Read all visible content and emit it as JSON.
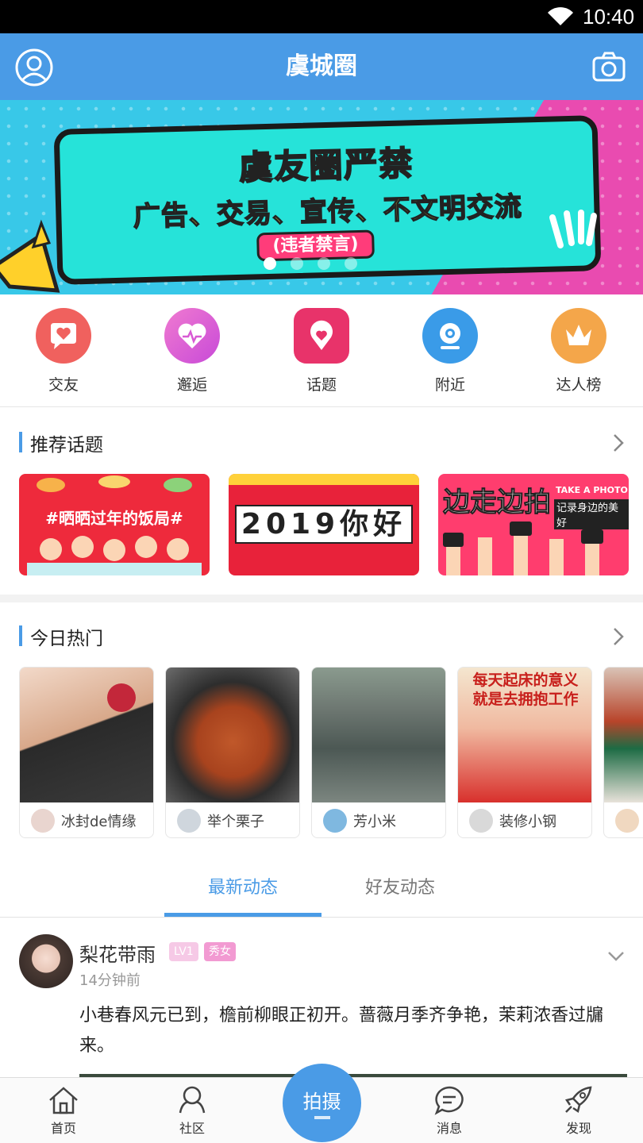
{
  "status_bar": {
    "time": "10:40",
    "icons": [
      "wifi-icon"
    ]
  },
  "header": {
    "title": "虞城圈",
    "left_icon": "user-avatar-icon",
    "right_icon": "camera-icon"
  },
  "banner": {
    "title": "虞友圈严禁",
    "subtitle": "广告、交易、宣传、不文明交流",
    "note": "(违者禁言)",
    "page_count": 4,
    "active_page": 1
  },
  "quick_entries": [
    {
      "label": "交友",
      "icon": "heart-chat-icon",
      "color": "#f0615e"
    },
    {
      "label": "邂逅",
      "icon": "heartbeat-icon",
      "color": "#d85ad4"
    },
    {
      "label": "话题",
      "icon": "heart-pin-icon",
      "color": "#e8336a"
    },
    {
      "label": "附近",
      "icon": "location-icon",
      "color": "#3a9be8"
    },
    {
      "label": "达人榜",
      "icon": "crown-icon",
      "color": "#f4a64a"
    }
  ],
  "recommended": {
    "title": "推荐话题",
    "topics": [
      {
        "text": "#晒晒过年的饭局#"
      },
      {
        "text": "2019你好"
      },
      {
        "text": "边走边拍",
        "tag": "TAKE A PHOTO",
        "caption": "记录身边的美好"
      }
    ]
  },
  "hot_today": {
    "title": "今日热门",
    "items": [
      {
        "name": "冰封de情缘"
      },
      {
        "name": "举个栗子"
      },
      {
        "name": "芳小米"
      },
      {
        "name": "装修小钢",
        "image_text": "每天起床的意义就是去拥抱工作"
      },
      {
        "name": ""
      }
    ]
  },
  "feed_tabs": {
    "tabs": [
      "最新动态",
      "好友动态"
    ],
    "active": 0
  },
  "post": {
    "author": "梨花带雨",
    "level": "LV1",
    "tag": "秀女",
    "time": "14分钟前",
    "text": "小巷春风元已到，檐前柳眼正初开。蔷薇月季齐争艳，茉莉浓香过牖来。"
  },
  "bottom_nav": {
    "items": [
      {
        "label": "首页",
        "icon": "home-icon"
      },
      {
        "label": "社区",
        "icon": "community-icon"
      },
      {
        "label": "消息",
        "icon": "message-icon"
      },
      {
        "label": "发现",
        "icon": "rocket-icon"
      }
    ],
    "center_button": "拍摄"
  }
}
